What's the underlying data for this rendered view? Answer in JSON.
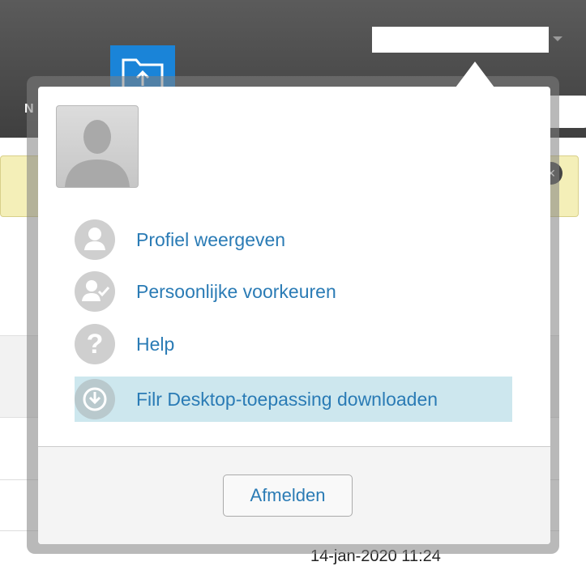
{
  "background": {
    "nav_letter": "N",
    "timestamp": "14-jan-2020 11:24",
    "notice_close_symbol": "×"
  },
  "user_menu": {
    "avatar_icon": "user-silhouette-icon",
    "items": [
      {
        "label": "Profiel weergeven",
        "icon": "person-icon",
        "highlighted": false
      },
      {
        "label": "Persoonlijke voorkeuren",
        "icon": "person-check-icon",
        "highlighted": false
      },
      {
        "label": "Help",
        "icon": "question-mark-icon",
        "highlighted": false
      },
      {
        "label": "Filr Desktop-toepassing downloaden",
        "icon": "download-icon",
        "highlighted": true
      }
    ],
    "logout_label": "Afmelden"
  },
  "colors": {
    "link": "#2a7bb5",
    "highlight": "#cde7ee",
    "icon_gray": "#cfcfcf",
    "accent_blue": "#1a84d8"
  }
}
